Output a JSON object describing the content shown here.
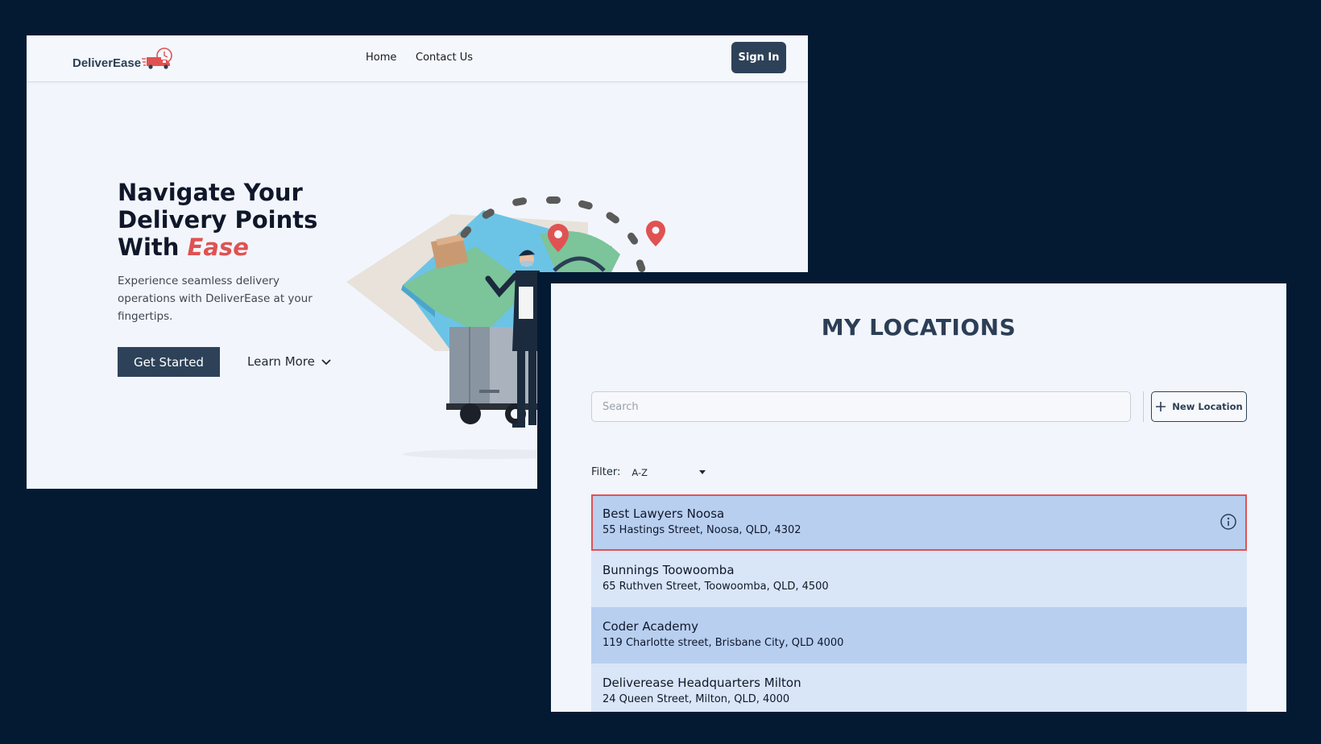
{
  "landing": {
    "logo_text": "DeliverEase",
    "nav": {
      "home": "Home",
      "contact": "Contact Us"
    },
    "signin_label": "Sign In",
    "hero": {
      "title_line1": "Navigate Your",
      "title_line2": "Delivery Points",
      "title_line3_prefix": "With ",
      "title_accent": "Ease",
      "subtitle": "Experience seamless delivery operations with DeliverEase at your fingertips.",
      "get_started_label": "Get Started",
      "learn_more_label": "Learn More"
    }
  },
  "locations": {
    "title": "MY LOCATIONS",
    "search_placeholder": "Search",
    "new_location_label": "New Location",
    "filter_label": "Filter:",
    "filter_value": "A-Z",
    "items": [
      {
        "name": "Best Lawyers Noosa",
        "address": "55 Hastings Street, Noosa, QLD, 4302"
      },
      {
        "name": "Bunnings Toowoomba",
        "address": "65 Ruthven Street, Toowoomba, QLD, 4500"
      },
      {
        "name": "Coder Academy",
        "address": "119 Charlotte street, Brisbane City, QLD 4000"
      },
      {
        "name": "Deliverease Headquarters Milton",
        "address": "24 Queen Street, Milton, QLD, 4000"
      }
    ]
  },
  "colors": {
    "brand_dark": "#2d4258",
    "accent": "#e05252",
    "background": "#041a33"
  }
}
